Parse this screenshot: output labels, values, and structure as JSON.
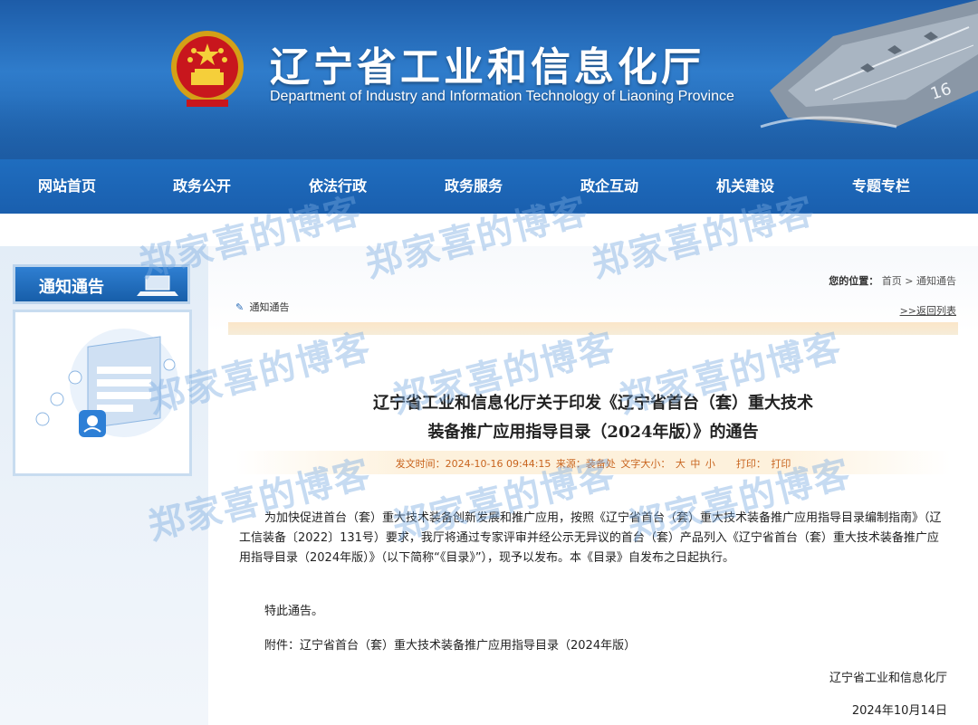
{
  "site": {
    "title": "辽宁省工业和信息化厅",
    "subtitle": "Department of Industry and Information Technology of Liaoning Province"
  },
  "nav": {
    "items": [
      "网站首页",
      "政务公开",
      "依法行政",
      "政务服务",
      "政企互动",
      "机关建设",
      "专题专栏"
    ]
  },
  "sidebar": {
    "tab_label": "通知通告"
  },
  "breadcrumb": {
    "label": "您的位置：",
    "home": "首页",
    "separator": ">",
    "current": "通知通告"
  },
  "section": {
    "label": "通知通告",
    "back_link": ">>返回列表"
  },
  "article": {
    "title_line1": "辽宁省工业和信息化厅关于印发《辽宁省首台（套）重大技术",
    "title_line2": "装备推广应用指导目录（2024年版）》的通告",
    "meta": {
      "publish_time": "发文时间：2024-10-16 09:44:15",
      "source": "来源：装备处",
      "font_size_label": "文字大小：",
      "font_large": "大",
      "font_medium": "中",
      "font_small": "小",
      "print_label": "打印：",
      "print": "打印"
    },
    "paragraph1": "为加快促进首台（套）重大技术装备创新发展和推广应用，按照《辽宁省首台（套）重大技术装备推广应用指导目录编制指南》（辽工信装备〔2022〕131号）要求，我厅将通过专家评审并经公示无异议的首台（套）产品列入《辽宁省首台（套）重大技术装备推广应用指导目录（2024年版）》（以下简称“《目录》”），现予以发布。本《目录》自发布之日起执行。",
    "paragraph2": "特此通告。",
    "attachment": "附件：辽宁省首台（套）重大技术装备推广应用指导目录（2024年版）",
    "signature_org": "辽宁省工业和信息化厅",
    "signature_date": "2024年10月14日"
  },
  "watermark": "郑家喜的博客",
  "colors": {
    "header_blue": "#1f6dbf",
    "meta_orange": "#c8641e",
    "watermark": "#78aae1"
  }
}
